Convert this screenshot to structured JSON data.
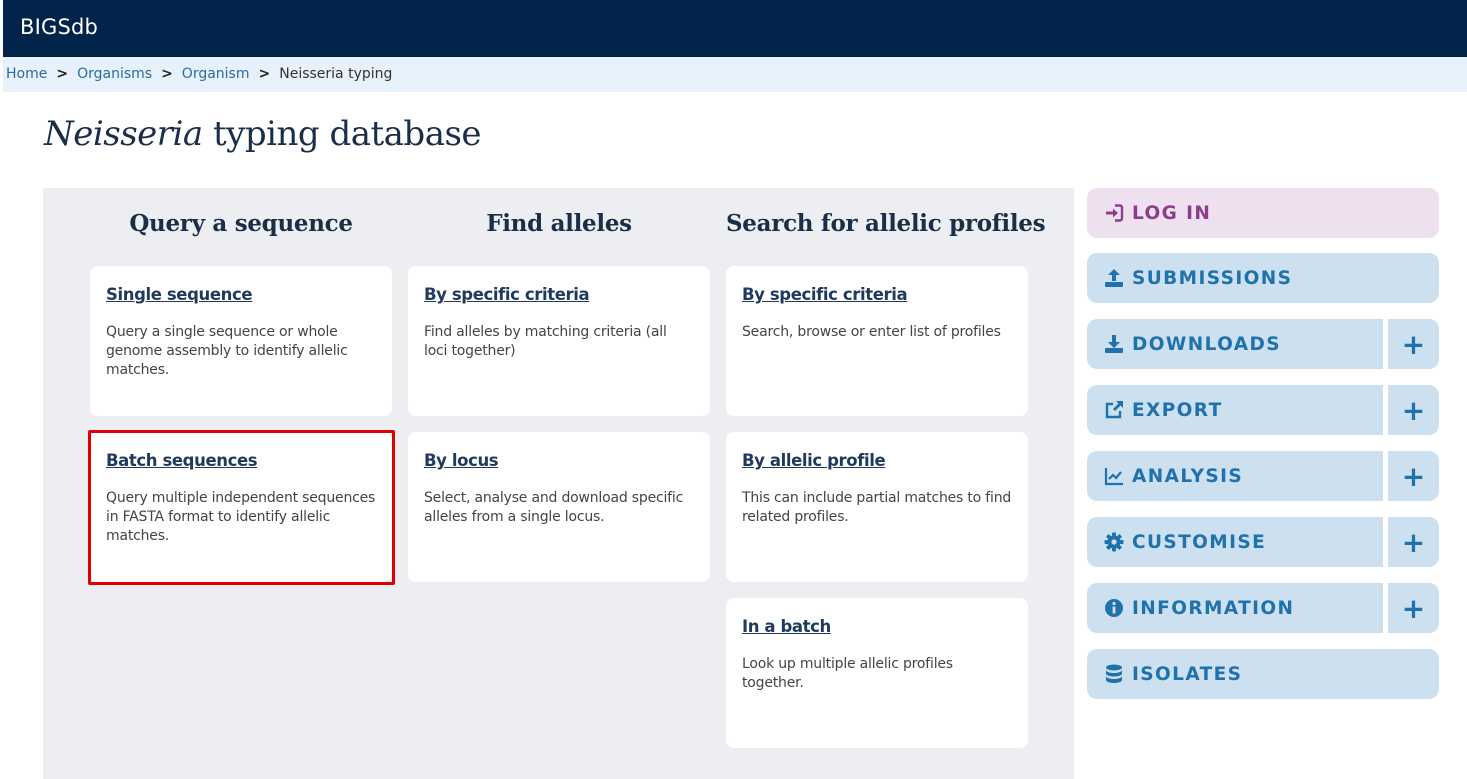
{
  "header": {
    "brand": "BIGSdb"
  },
  "breadcrumb": [
    {
      "label": "Home"
    },
    {
      "label": "Organisms"
    },
    {
      "label": "Organism"
    },
    {
      "label": "Neisseria typing"
    }
  ],
  "page_title": {
    "italic": "Neisseria",
    "rest": " typing database"
  },
  "columns": [
    {
      "heading": "Query a sequence",
      "cards": [
        {
          "link": "Single sequence",
          "desc": "Query a single sequence or whole genome assembly to identify allelic matches."
        },
        {
          "link": "Batch sequences",
          "desc": "Query multiple independent sequences in FASTA format to identify allelic matches."
        }
      ]
    },
    {
      "heading": "Find alleles",
      "cards": [
        {
          "link": "By specific criteria",
          "desc": "Find alleles by matching criteria (all loci together)"
        },
        {
          "link": "By locus",
          "desc": "Select, analyse and download specific alleles from a single locus."
        }
      ]
    },
    {
      "heading": "Search for allelic profiles",
      "cards": [
        {
          "link": "By specific criteria",
          "desc": "Search, browse or enter list of profiles"
        },
        {
          "link": "By allelic profile",
          "desc": "This can include partial matches to find related profiles."
        },
        {
          "link": "In a batch",
          "desc": "Look up multiple allelic profiles together."
        }
      ]
    }
  ],
  "sidebar": {
    "login": {
      "label": "LOG IN",
      "icon": "sign-in-icon"
    },
    "submissions": {
      "label": "SUBMISSIONS",
      "icon": "upload-icon"
    },
    "downloads": {
      "label": "DOWNLOADS",
      "icon": "download-icon",
      "expand": "+"
    },
    "export": {
      "label": "EXPORT",
      "icon": "external-link-icon",
      "expand": "+"
    },
    "analysis": {
      "label": "ANALYSIS",
      "icon": "chart-line-icon",
      "expand": "+"
    },
    "customise": {
      "label": "CUSTOMISE",
      "icon": "gear-icon",
      "expand": "+"
    },
    "information": {
      "label": "INFORMATION",
      "icon": "info-circle-icon",
      "expand": "+"
    },
    "isolates": {
      "label": "ISOLATES",
      "icon": "database-icon"
    }
  },
  "colors": {
    "topbar": "#02244a",
    "breadcrumb_bg": "#e6f1fc",
    "panel_bg": "#eceef2",
    "sidebar_btn": "#cce0f0",
    "sidebar_text": "#1f72ab",
    "login_bg": "#eee0ee",
    "login_text": "#8b3f8b",
    "highlight": "#e00000"
  }
}
